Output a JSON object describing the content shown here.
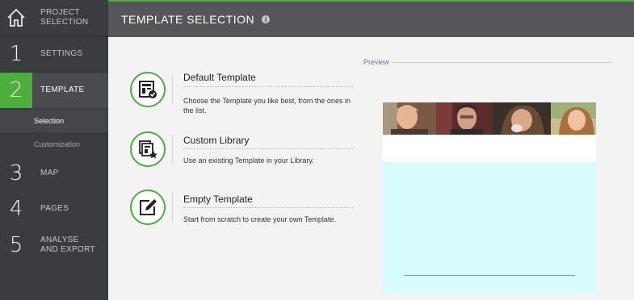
{
  "sidebar": {
    "project_selection": "PROJECT SELECTION",
    "steps": [
      {
        "num": "1",
        "label": "SETTINGS"
      },
      {
        "num": "2",
        "label": "TEMPLATE"
      },
      {
        "num": "3",
        "label": "MAP"
      },
      {
        "num": "4",
        "label": "PAGES"
      },
      {
        "num": "5",
        "label": "ANALYSE AND EXPORT"
      }
    ],
    "sub_items": [
      "Selection",
      "Customization"
    ]
  },
  "header": {
    "title": "TEMPLATE SELECTION",
    "info_icon": "i"
  },
  "options": [
    {
      "title": "Default Template",
      "description": "Choose the Template you like best, from the ones in the list.",
      "icon": "template-check-icon"
    },
    {
      "title": "Custom Library",
      "description": "Use an existing Template in your Library.",
      "icon": "library-star-icon"
    },
    {
      "title": "Empty Template",
      "description": "Start from scratch to create your own Template.",
      "icon": "edit-pen-icon"
    }
  ],
  "preview": {
    "label": "Preview"
  },
  "colors": {
    "accent": "#4caf3c",
    "sidebar": "#3b3c3f",
    "header": "#55565a",
    "preview_bg": "#d6fcfd",
    "link": "#4f7fb4"
  }
}
